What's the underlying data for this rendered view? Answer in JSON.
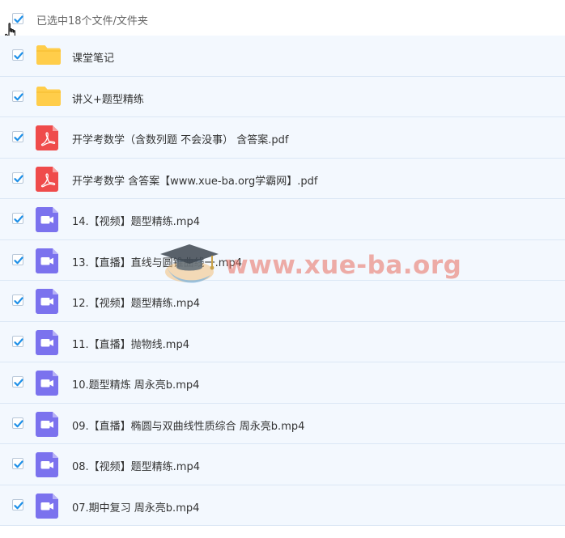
{
  "header": {
    "selection_label": "已选中18个文件/文件夹"
  },
  "files": [
    {
      "type": "folder",
      "name": "课堂笔记"
    },
    {
      "type": "folder",
      "name": "讲义+题型精练"
    },
    {
      "type": "pdf",
      "name": "开学考数学（含数列题 不会没事） 含答案.pdf"
    },
    {
      "type": "pdf",
      "name": "开学考数学 含答案【www.xue-ba.org学霸网】.pdf"
    },
    {
      "type": "video",
      "name": "14.【视频】题型精练.mp4"
    },
    {
      "type": "video",
      "name": "13.【直播】直线与圆锥曲线一.mp4"
    },
    {
      "type": "video",
      "name": "12.【视频】题型精练.mp4"
    },
    {
      "type": "video",
      "name": "11.【直播】抛物线.mp4"
    },
    {
      "type": "video",
      "name": "10.题型精炼 周永亮b.mp4"
    },
    {
      "type": "video",
      "name": "09.【直播】椭圆与双曲线性质综合 周永亮b.mp4"
    },
    {
      "type": "video",
      "name": "08.【视频】题型精练.mp4"
    },
    {
      "type": "video",
      "name": "07.期中复习 周永亮b.mp4"
    }
  ],
  "watermark": {
    "text": "www.xue-ba.org"
  },
  "icons": {
    "checkbox": "checkmark-icon",
    "folder": "folder-icon",
    "pdf": "pdf-file-icon",
    "video": "video-file-icon",
    "cursor": "hand-pointer-icon",
    "watermark_logo": "graduation-cap-icon"
  },
  "colors": {
    "accent": "#1e90e8",
    "row_bg": "#f3f8fe",
    "row_border": "#dbe7f5",
    "folder": "#ffcd4a",
    "pdf": "#ef4b4b",
    "video": "#7b72ee"
  }
}
